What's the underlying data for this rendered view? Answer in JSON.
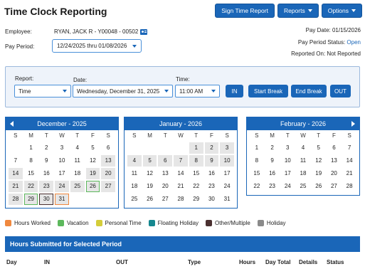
{
  "header": {
    "title": "Time Clock Reporting",
    "sign_button": "Sign Time Report",
    "reports_button": "Reports",
    "options_button": "Options"
  },
  "employee": {
    "label": "Employee:",
    "value": "RYAN, JACK R - Y00048 - 00502",
    "icon": "id-card-icon"
  },
  "pay_period": {
    "label": "Pay Period:",
    "value": "12/24/2025 thru 01/08/2026"
  },
  "right_info": {
    "pay_date": "Pay Date: 01/15/2026",
    "status_label": "Pay Period Status:",
    "status_value": "Open",
    "reported_on": "Reported On: Not Reported"
  },
  "form": {
    "report_label": "Report:",
    "report_value": "Time",
    "date_label": "Date:",
    "date_value": "Wednesday, December 31, 2025",
    "time_label": "Time:",
    "time_value": "11:00 AM",
    "in_button": "IN",
    "start_break_button": "Start Break",
    "end_break_button": "End Break",
    "out_button": "OUT"
  },
  "calendars": [
    {
      "title": "December - 2025",
      "dow": [
        "S",
        "M",
        "T",
        "W",
        "T",
        "F",
        "S"
      ],
      "weeks": [
        [
          "",
          "1",
          "2",
          "3",
          "4",
          "5",
          "6"
        ],
        [
          "7",
          "8",
          "9",
          "10",
          "11",
          "12",
          "13"
        ],
        [
          "14",
          "15",
          "16",
          "17",
          "18",
          "19",
          "20"
        ],
        [
          "21",
          "22",
          "23",
          "24",
          "25",
          "26",
          "27"
        ],
        [
          "28",
          "29",
          "30",
          "31",
          "",
          "",
          ""
        ]
      ]
    },
    {
      "title": "January - 2026",
      "dow": [
        "S",
        "M",
        "T",
        "W",
        "T",
        "F",
        "S"
      ],
      "weeks": [
        [
          "",
          "",
          "",
          "",
          "1",
          "2",
          "3"
        ],
        [
          "4",
          "5",
          "6",
          "7",
          "8",
          "9",
          "10"
        ],
        [
          "11",
          "12",
          "13",
          "14",
          "15",
          "16",
          "17"
        ],
        [
          "18",
          "19",
          "20",
          "21",
          "22",
          "23",
          "24"
        ],
        [
          "25",
          "26",
          "27",
          "28",
          "29",
          "30",
          "31"
        ]
      ]
    },
    {
      "title": "February - 2026",
      "dow": [
        "S",
        "M",
        "T",
        "W",
        "T",
        "F",
        "S"
      ],
      "weeks": [
        [
          "1",
          "2",
          "3",
          "4",
          "5",
          "6",
          "7"
        ],
        [
          "8",
          "9",
          "10",
          "11",
          "12",
          "13",
          "14"
        ],
        [
          "15",
          "16",
          "17",
          "18",
          "19",
          "20",
          "21"
        ],
        [
          "22",
          "23",
          "24",
          "25",
          "26",
          "27",
          "28"
        ]
      ]
    }
  ],
  "legend": [
    {
      "label": "Hours Worked",
      "color": "#f0883e"
    },
    {
      "label": "Vacation",
      "color": "#5cb85c"
    },
    {
      "label": "Personal Time",
      "color": "#d4cd3a"
    },
    {
      "label": "Floating Holiday",
      "color": "#15878f"
    },
    {
      "label": "Other/Multiple",
      "color": "#4a3030"
    },
    {
      "label": "Holiday",
      "color": "#8a8a8a"
    }
  ],
  "hours_section": {
    "title": "Hours Submitted for Selected Period",
    "columns": [
      "Day",
      "IN",
      "OUT",
      "Type",
      "Hours",
      "Day Total",
      "Details",
      "Status"
    ]
  }
}
